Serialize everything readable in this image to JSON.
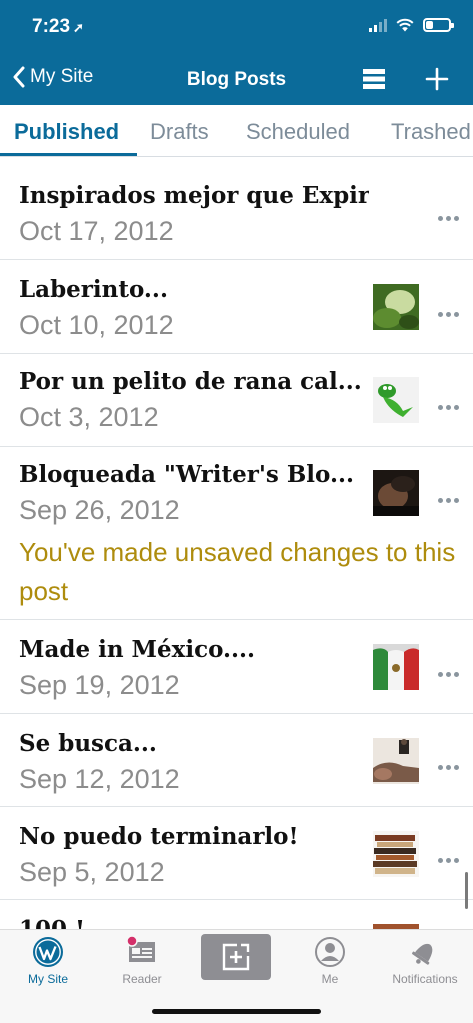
{
  "status": {
    "time": "7:23",
    "location_icon": "location-arrow-icon"
  },
  "nav": {
    "back_label": "My Site",
    "title": "Blog Posts"
  },
  "tabs": [
    {
      "label": "Published"
    },
    {
      "label": "Drafts"
    },
    {
      "label": "Scheduled"
    },
    {
      "label": "Trashed"
    }
  ],
  "posts": [
    {
      "title": "Inspirados mejor que Expir...",
      "date": "Oct 17, 2012"
    },
    {
      "title": "Laberinto...",
      "date": "Oct 10, 2012"
    },
    {
      "title": "Por un pelito de rana cal...",
      "date": "Oct 3, 2012"
    },
    {
      "title": "Bloqueada \"Writer's Blo...",
      "date": "Sep 26, 2012",
      "warning": "You've made unsaved changes to this post"
    },
    {
      "title": "Made in México....",
      "date": "Sep 19, 2012"
    },
    {
      "title": "Se busca...",
      "date": "Sep 12, 2012"
    },
    {
      "title": "No puedo terminarlo!",
      "date": "Sep 5, 2012"
    },
    {
      "title": "100 !",
      "date": ""
    }
  ],
  "tabbar": {
    "my_site": "My Site",
    "reader": "Reader",
    "me": "Me",
    "notifications": "Notifications"
  },
  "colors": {
    "brand": "#0b6b9a",
    "warning": "#ae8c0d",
    "date": "#8c8c8c"
  }
}
